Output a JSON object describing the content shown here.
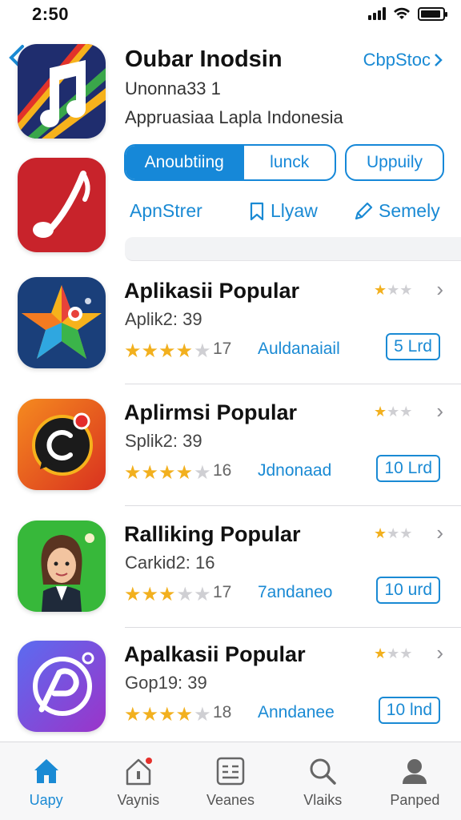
{
  "status": {
    "time": "2:50"
  },
  "hero": {
    "title": "Oubar Inodsin",
    "link": "CbpStoc",
    "subtitle1": "Unonna33 1",
    "subtitle2": "Appruasiaa Lapla Indonesia",
    "segments": [
      "Anoubtiing",
      "lunck"
    ],
    "pill_button": "Uppuily",
    "actions": [
      {
        "label": "ApnStrer",
        "icon": "none"
      },
      {
        "label": "Llyaw",
        "icon": "bookmark-icon"
      },
      {
        "label": "Semely",
        "icon": "pencil-icon"
      }
    ]
  },
  "apps": [
    {
      "title": "Aplikasii Popular",
      "subtitle": "Aplik2: 39",
      "rating": 4.5,
      "count": "17",
      "link": "Auldanaiail",
      "badge": "5 Lrd",
      "mini_rating": 1
    },
    {
      "title": "Aplirmsi Popular",
      "subtitle": "Splik2: 39",
      "rating": 4.5,
      "count": "16",
      "link": "Jdnonaad",
      "badge": "10 Lrd",
      "mini_rating": 1
    },
    {
      "title": "Ralliking Popular",
      "subtitle": "Carkid2: 16",
      "rating": 3.5,
      "count": "17",
      "link": "7andaneo",
      "badge": "10 urd",
      "mini_rating": 1
    },
    {
      "title": "Apalkasii Popular",
      "subtitle": "Gop19: 39",
      "rating": 4.5,
      "count": "18",
      "link": "Anndanee",
      "badge": "10 lnd",
      "mini_rating": 1
    }
  ],
  "tabs": [
    {
      "label": "Uapy",
      "icon": "home-icon",
      "active": true
    },
    {
      "label": "Vaynis",
      "icon": "house-badge-icon",
      "active": false
    },
    {
      "label": "Veanes",
      "icon": "list-icon",
      "active": false
    },
    {
      "label": "Vlaiks",
      "icon": "search-icon",
      "active": false
    },
    {
      "label": "Panped",
      "icon": "profile-icon",
      "active": false
    }
  ],
  "colors": {
    "accent": "#1688d8",
    "star": "#f2b01e"
  }
}
